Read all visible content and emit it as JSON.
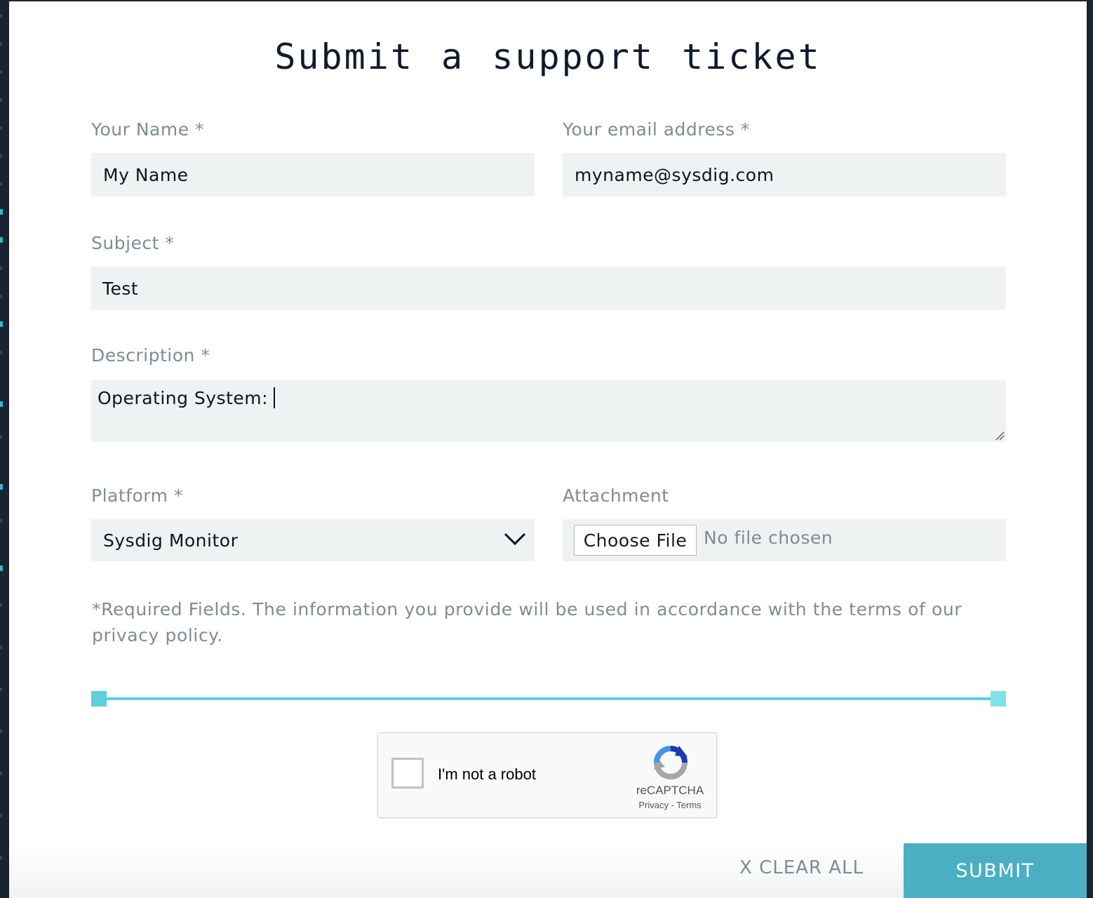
{
  "title": "Submit a support ticket",
  "fields": {
    "name": {
      "label": "Your Name *",
      "value": "My Name"
    },
    "email": {
      "label": "Your email address *",
      "value": "myname@sysdig.com"
    },
    "subject": {
      "label": "Subject *",
      "value": "Test"
    },
    "description": {
      "label": "Description *",
      "value": "Operating System:"
    },
    "platform": {
      "label": "Platform *",
      "selected": "Sysdig Monitor"
    },
    "attachment": {
      "label": "Attachment",
      "button": "Choose File",
      "status": "No file chosen"
    }
  },
  "note": "*Required Fields. The information you provide will be used in accordance with the terms of our privacy policy.",
  "captcha": {
    "label": "I'm not a robot",
    "brand": "reCAPTCHA",
    "links": "Privacy - Terms"
  },
  "actions": {
    "clear_all": "X CLEAR ALL",
    "submit": "SUBMIT"
  },
  "colors": {
    "accent": "#5ed0db",
    "submit": "#4aafc3",
    "field_bg": "#eef2f3",
    "label": "#7d8c97",
    "title": "#0f1b2d"
  },
  "icons": {
    "platform_dropdown": "chevron-down-icon",
    "captcha_logo": "recaptcha-icon",
    "textarea_resize": "resize-grip-icon"
  }
}
